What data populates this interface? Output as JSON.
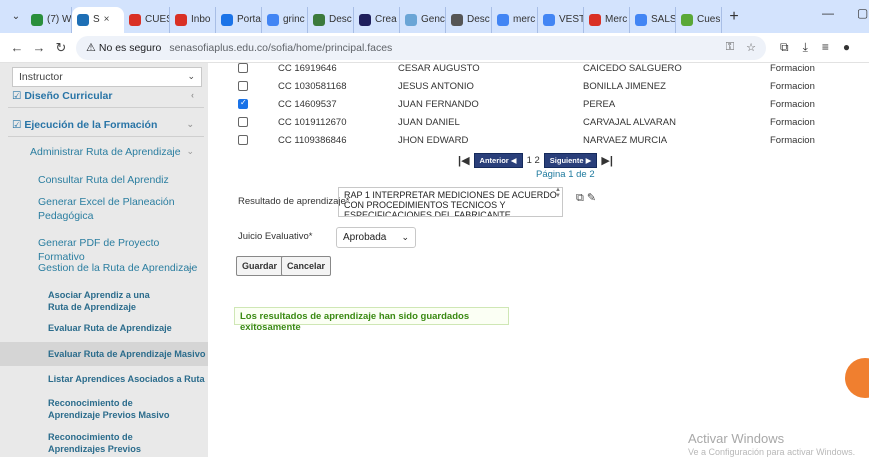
{
  "browser": {
    "tabs": [
      {
        "label": "(7) W",
        "color": "#2a8f3c",
        "active": false
      },
      {
        "label": "S",
        "color": "#1e6fb5",
        "active": true
      },
      {
        "label": "CUES",
        "color": "#d93025",
        "active": false
      },
      {
        "label": "Inbo",
        "color": "#d93025",
        "active": false
      },
      {
        "label": "Porta",
        "color": "#1a73e8",
        "active": false
      },
      {
        "label": "grinc",
        "color": "#4285f4",
        "active": false
      },
      {
        "label": "Desc",
        "color": "#3c7a3c",
        "active": false
      },
      {
        "label": "Crea",
        "color": "#1f1f5c",
        "active": false
      },
      {
        "label": "Genc",
        "color": "#6aa5d6",
        "active": false
      },
      {
        "label": "Desc",
        "color": "#555555",
        "active": false
      },
      {
        "label": "merc",
        "color": "#4285f4",
        "active": false
      },
      {
        "label": "VEST",
        "color": "#4285f4",
        "active": false
      },
      {
        "label": "Merc",
        "color": "#d93025",
        "active": false
      },
      {
        "label": "SALS",
        "color": "#4285f4",
        "active": false
      },
      {
        "label": "Cues",
        "color": "#5aa837",
        "active": false
      }
    ],
    "new_tab": "+",
    "security_label": "No es seguro",
    "url": "senasofiaplus.edu.co/sofia/home/principal.faces"
  },
  "sidebar": {
    "role_select": "Instructor",
    "diseno": "Diseño Curricular",
    "ejecucion": "Ejecución de la Formación",
    "administrar": "Administrar Ruta de Aprendizaje",
    "consultar": "Consultar Ruta del Aprendiz",
    "excel": "Generar Excel de Planeación Pedagógica",
    "pdf": "Generar PDF de Proyecto Formativo",
    "gestion": "Gestion de la Ruta de Aprendizaje",
    "asociar": "Asociar Aprendiz a una Ruta de Aprendizaje",
    "evaluar": "Evaluar Ruta de Aprendizaje",
    "evaluar_masivo": "Evaluar Ruta de Aprendizaje Masivo",
    "listar": "Listar Aprendices Asociados a Ruta",
    "reconocimiento_masivo": "Reconocimiento de Aprendizaje Previos Masivo",
    "reconocimiento": "Reconocimiento de Aprendizajes Previos"
  },
  "table": {
    "rows": [
      {
        "doc": "CC 16919646",
        "nombres": "CESAR AUGUSTO",
        "apellidos": "CAICEDO SALGUERO",
        "estado": "Formacion",
        "checked": false
      },
      {
        "doc": "CC 1030581168",
        "nombres": "JESUS ANTONIO",
        "apellidos": "BONILLA JIMENEZ",
        "estado": "Formacion",
        "checked": false
      },
      {
        "doc": "CC 14609537",
        "nombres": "JUAN FERNANDO",
        "apellidos": "PEREA",
        "estado": "Formacion",
        "checked": true
      },
      {
        "doc": "CC 1019112670",
        "nombres": "JUAN DANIEL",
        "apellidos": "CARVAJAL ALVARAN",
        "estado": "Formacion",
        "checked": false
      },
      {
        "doc": "CC 1109386846",
        "nombres": "JHON EDWARD",
        "apellidos": "NARVAEZ MURCIA",
        "estado": "Formacion",
        "checked": false
      }
    ]
  },
  "pager": {
    "first": "|◀",
    "prev": "Anterior ◀",
    "pages": "1 2",
    "next": "Siguiente ▶",
    "last": "▶|",
    "page_of": "Página 1 de 2"
  },
  "form": {
    "resultado_label": "Resultado de aprendizaje*",
    "resultado_value": "RAP 1 INTERPRETAR MEDICIONES DE ACUERDO CON PROCEDIMIENTOS TECNICOS Y ESPECIFICACIONES DEL FABRICANTE",
    "juicio_label": "Juicio Evaluativo*",
    "juicio_value": "Aprobada",
    "guardar": "Guardar",
    "cancelar": "Cancelar",
    "success_msg": "Los resultados de aprendizaje han sido guardados exitosamente"
  },
  "watermark": {
    "title": "Activar Windows",
    "subtitle": "Ve a Configuración para activar Windows."
  }
}
